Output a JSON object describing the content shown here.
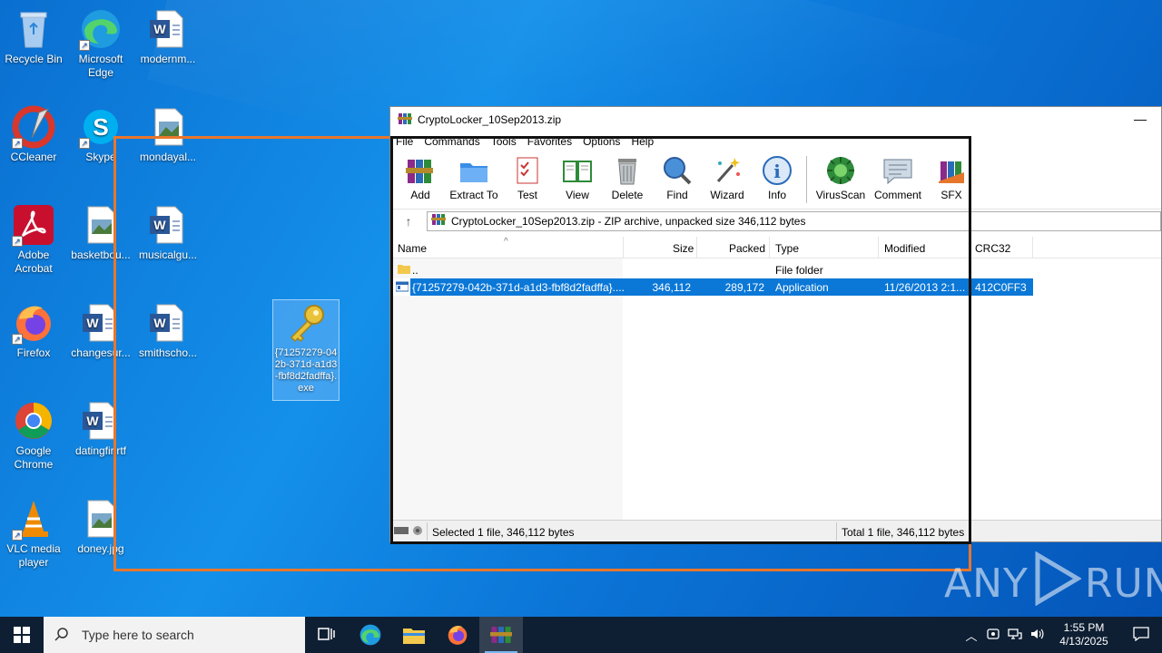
{
  "desktop": {
    "icons": [
      {
        "label": "Recycle Bin"
      },
      {
        "label": "Microsoft Edge"
      },
      {
        "label": "modernm..."
      },
      {
        "label": "CCleaner"
      },
      {
        "label": "Skype"
      },
      {
        "label": "mondayal..."
      },
      {
        "label": "Adobe Acrobat"
      },
      {
        "label": "basketbou..."
      },
      {
        "label": "musicalgu..."
      },
      {
        "label": "Firefox"
      },
      {
        "label": "changesur..."
      },
      {
        "label": "smithscho..."
      },
      {
        "label": "Google Chrome"
      },
      {
        "label": "datingfir.rtf"
      },
      {
        "label": "VLC media player"
      },
      {
        "label": "doney.jpg"
      },
      {
        "label": "{71257279-042b-371d-a1d3-fbf8d2fadffa}.exe"
      }
    ]
  },
  "window": {
    "title": "CryptoLocker_10Sep2013.zip",
    "minimize": "—",
    "menu": [
      "File",
      "Commands",
      "Tools",
      "Favorites",
      "Options",
      "Help"
    ],
    "toolbar": [
      "Add",
      "Extract To",
      "Test",
      "View",
      "Delete",
      "Find",
      "Wizard",
      "Info",
      "VirusScan",
      "Comment",
      "SFX"
    ],
    "address": "CryptoLocker_10Sep2013.zip - ZIP archive, unpacked size 346,112 bytes",
    "columns": [
      "Name",
      "Size",
      "Packed",
      "Type",
      "Modified",
      "CRC32"
    ],
    "rows": [
      {
        "name": "..",
        "size": "",
        "packed": "",
        "type": "File folder",
        "modified": "",
        "crc": ""
      },
      {
        "name": "{71257279-042b-371d-a1d3-fbf8d2fadffa}....",
        "size": "346,112",
        "packed": "289,172",
        "type": "Application",
        "modified": "11/26/2013 2:1...",
        "crc": "412C0FF3"
      }
    ],
    "status_left": "Selected 1 file, 346,112 bytes",
    "status_right": "Total 1 file, 346,112 bytes"
  },
  "watermark": {
    "left": "ANY",
    "right": "RUN"
  },
  "taskbar": {
    "search_placeholder": "Type here to search",
    "time": "1:55 PM",
    "date": "4/13/2025"
  },
  "colors": {
    "selection": "#0b78d7",
    "taskbar": "#0f1f33",
    "orange_frame": "#e8762b"
  }
}
